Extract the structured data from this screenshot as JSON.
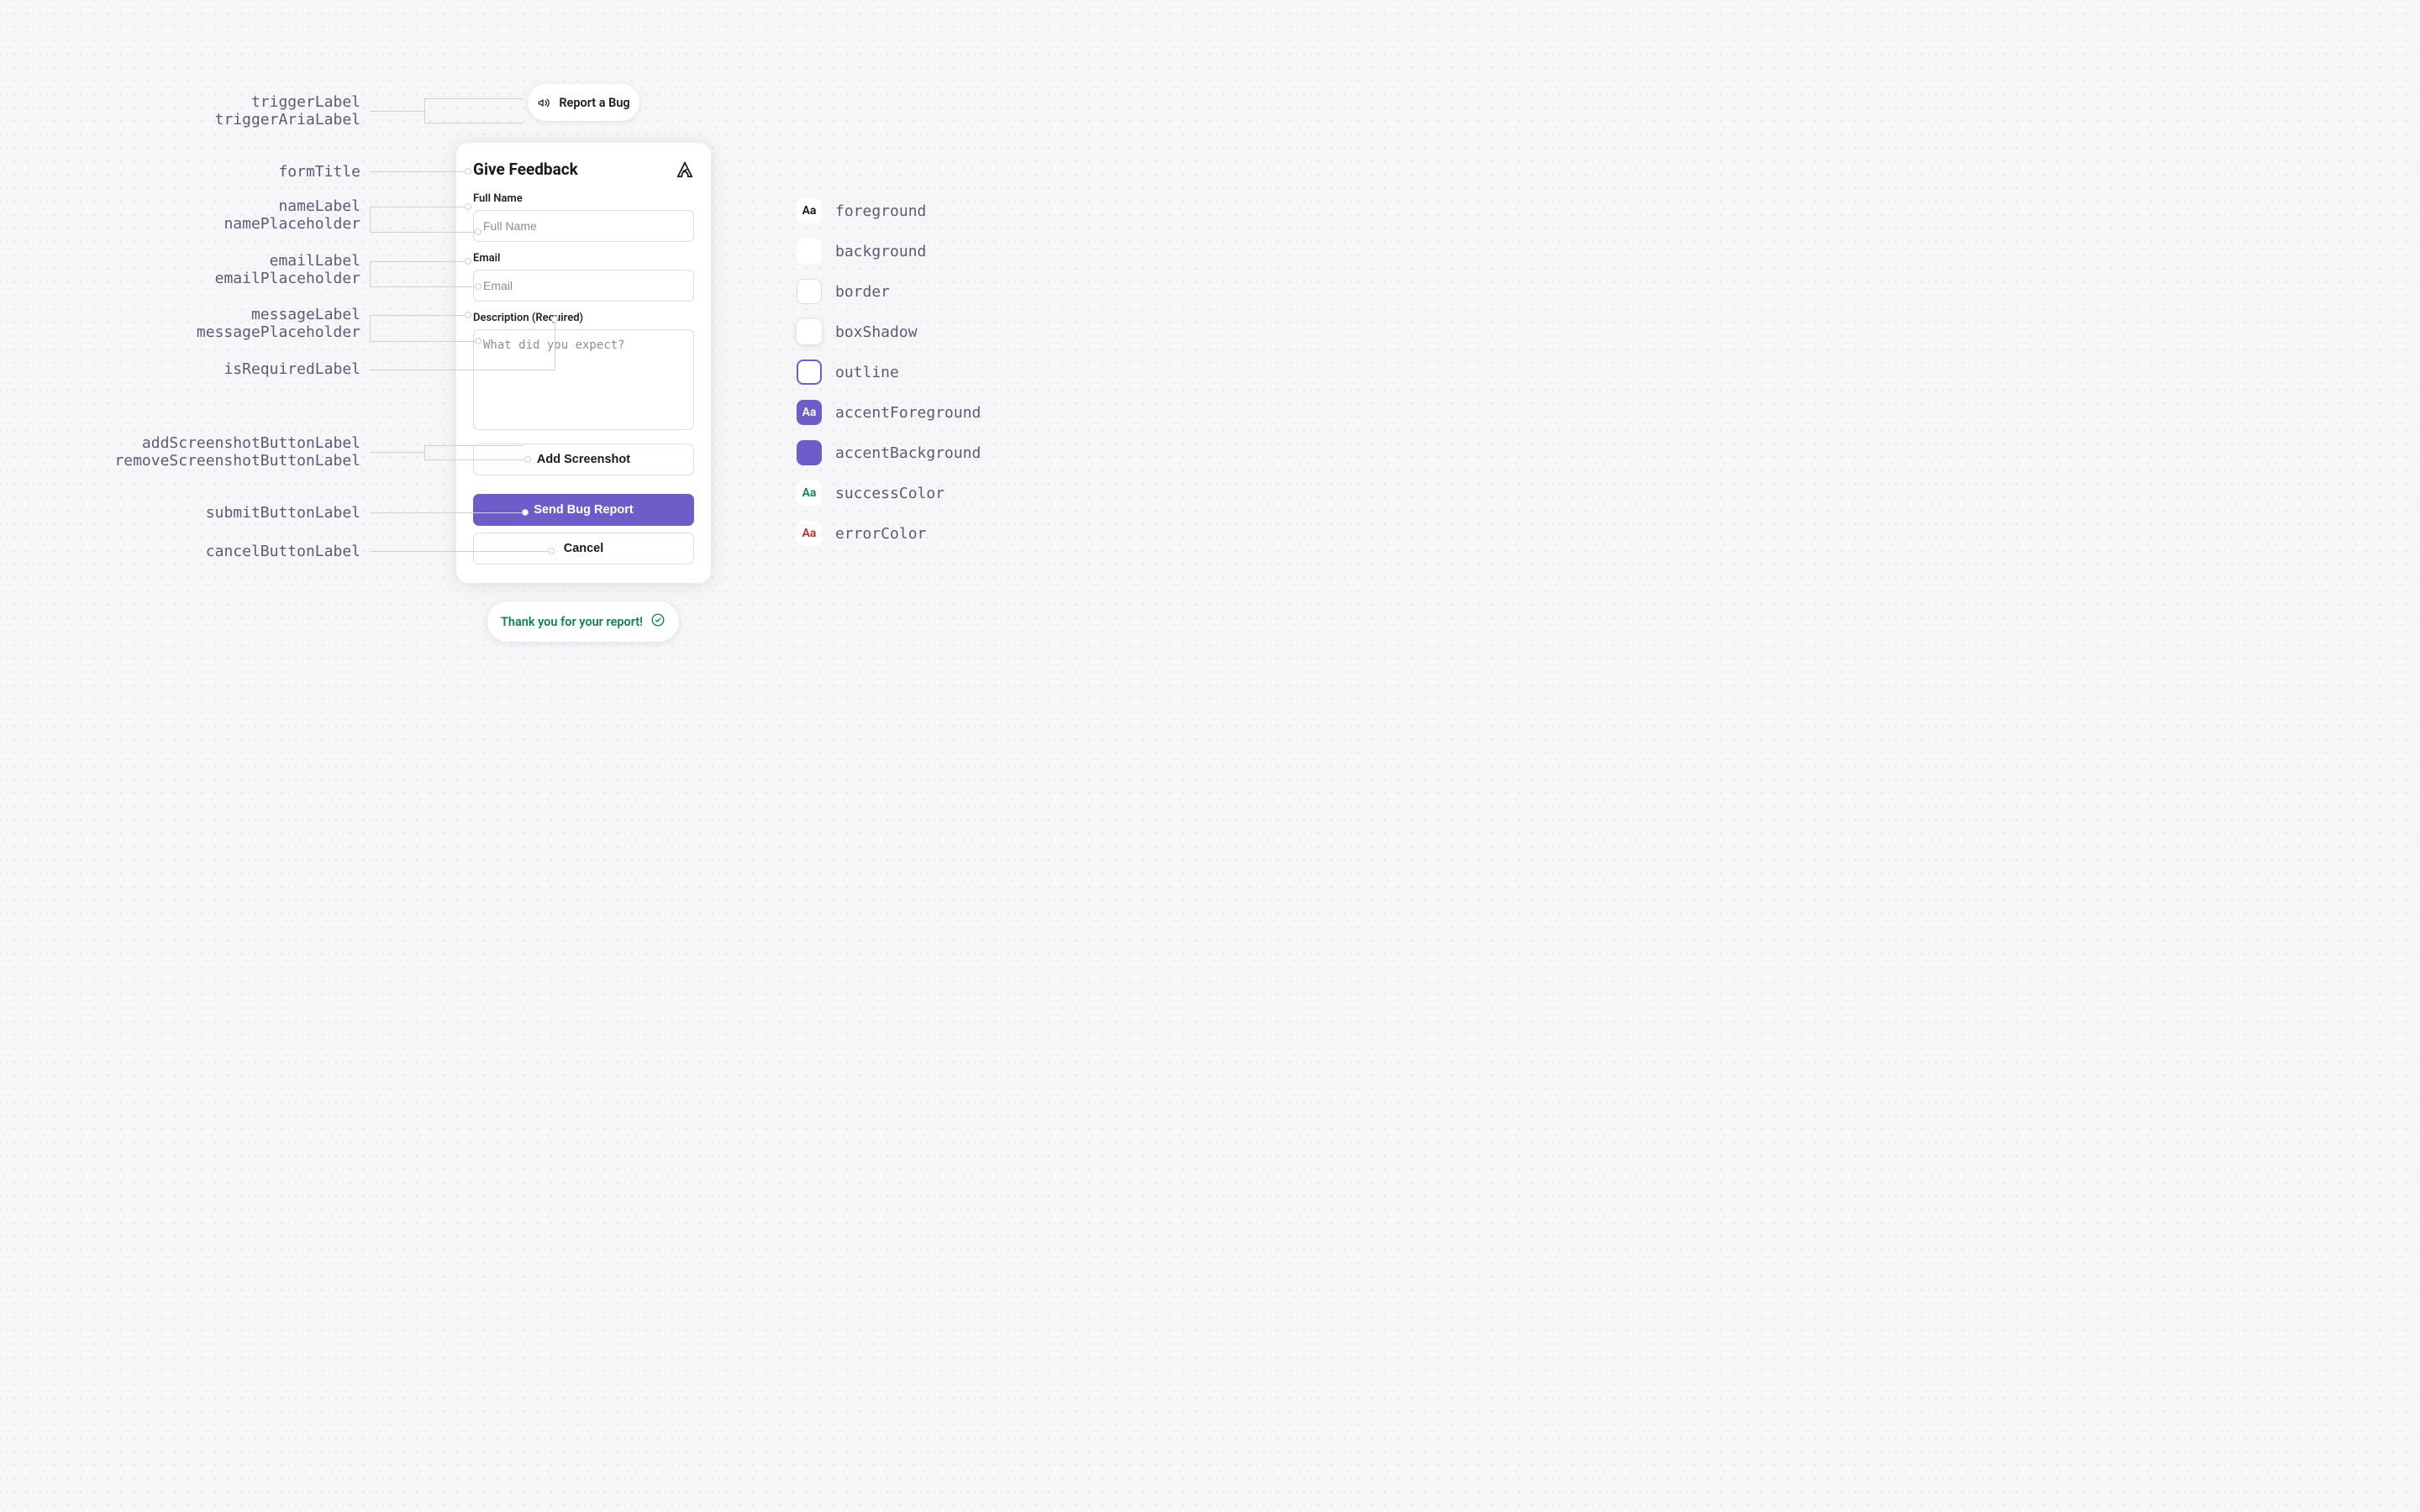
{
  "trigger": {
    "label": "Report a Bug",
    "icon": "megaphone-icon"
  },
  "form": {
    "title": "Give Feedback",
    "brand_icon": "sentry-icon",
    "name": {
      "label": "Full Name",
      "placeholder": "Full Name"
    },
    "email": {
      "label": "Email",
      "placeholder": "Email"
    },
    "message": {
      "label": "Description (Required)",
      "placeholder": "What did you expect?"
    },
    "addScreenshot": "Add Screenshot",
    "submit": "Send Bug Report",
    "cancel": "Cancel"
  },
  "success": {
    "message": "Thank you for your report!",
    "icon": "check-circle-icon"
  },
  "annotations": {
    "left": [
      "triggerLabel",
      "triggerAriaLabel",
      "formTitle",
      "nameLabel",
      "namePlaceholder",
      "emailLabel",
      "emailPlaceholder",
      "messageLabel",
      "messagePlaceholder",
      "isRequiredLabel",
      "addScreenshotButtonLabel",
      "removeScreenshotButtonLabel",
      "submitButtonLabel",
      "cancelButtonLabel"
    ]
  },
  "legend": [
    {
      "key": "foreground",
      "swatch": "sw-foreground",
      "aa": true
    },
    {
      "key": "background",
      "swatch": "sw-background",
      "aa": false
    },
    {
      "key": "border",
      "swatch": "sw-border",
      "aa": false
    },
    {
      "key": "boxShadow",
      "swatch": "sw-boxshadow",
      "aa": false
    },
    {
      "key": "outline",
      "swatch": "sw-outline",
      "aa": false
    },
    {
      "key": "accentForeground",
      "swatch": "sw-accentfg",
      "aa": true
    },
    {
      "key": "accentBackground",
      "swatch": "sw-accentbg",
      "aa": false
    },
    {
      "key": "successColor",
      "swatch": "sw-success",
      "aa": true
    },
    {
      "key": "errorColor",
      "swatch": "sw-error",
      "aa": true
    }
  ]
}
